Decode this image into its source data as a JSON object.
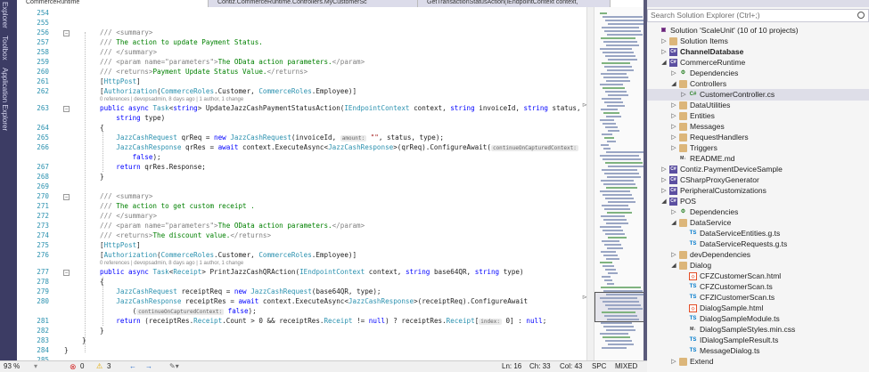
{
  "left_tabs": [
    "Explorer",
    "Toolbox",
    "Application Explorer"
  ],
  "tabs": [
    {
      "label": "CommerceRuntime"
    },
    {
      "label": "Contiz.CommerceRuntime.Controllers.MyCustomerSc"
    },
    {
      "label": "GetTransactionStatusAction(IEndpointContext context,"
    }
  ],
  "editor": {
    "lines": [
      {
        "num": "254"
      },
      {
        "num": "255"
      },
      {
        "num": "256",
        "text": "/// <summary>"
      },
      {
        "num": "257",
        "text": "/// The action to update Payment Status."
      },
      {
        "num": "258",
        "text": "/// </summary>"
      },
      {
        "num": "259",
        "text": "/// <param name=\"parameters\">The OData action parameters.</param>"
      },
      {
        "num": "260",
        "text": "/// <returns>Payment Update Status Value.</returns>"
      },
      {
        "num": "261",
        "text": "[HttpPost]"
      },
      {
        "num": "262",
        "text": "[Authorization(CommerceRoles.Customer, CommerceRoles.Employee)]"
      },
      {
        "num": "263",
        "text": "public async Task<string> UpdateJazzCashPaymentStatusAction(IEndpointContext context, string invoiceId, string status,"
      },
      {
        "num": "",
        "text": "    string type)"
      },
      {
        "num": "264",
        "text": "{"
      },
      {
        "num": "265",
        "text": "    JazzCashRequest qrReq = new JazzCashRequest(invoiceId, amount: \"\", status, type);"
      },
      {
        "num": "266",
        "text": "    JazzCashResponse qrRes = await context.ExecuteAsync<JazzCashResponse>(qrReq).ConfigureAwait(continueOnCapturedContext:"
      },
      {
        "num": "",
        "text": "        false);"
      },
      {
        "num": "267",
        "text": "    return qrRes.Response;"
      },
      {
        "num": "268",
        "text": "}"
      },
      {
        "num": "269"
      },
      {
        "num": "270",
        "text": "/// <summary>"
      },
      {
        "num": "271",
        "text": "/// The action to get custom receipt ."
      },
      {
        "num": "272",
        "text": "/// </summary>"
      },
      {
        "num": "273",
        "text": "/// <param name=\"parameters\">The OData action parameters.</param>"
      },
      {
        "num": "274",
        "text": "/// <returns>The discount value.</returns>"
      },
      {
        "num": "275",
        "text": "[HttpPost]"
      },
      {
        "num": "276",
        "text": "[Authorization(CommerceRoles.Customer, CommerceRoles.Employee)]"
      },
      {
        "num": "277",
        "text": "public async Task<Receipt> PrintJazzCashQRAction(IEndpointContext context, string base64QR, string type)"
      },
      {
        "num": "278",
        "text": "{"
      },
      {
        "num": "279",
        "text": "    JazzCashRequest receiptReq = new JazzCashRequest(base64QR, type);"
      },
      {
        "num": "280",
        "text": "    JazzCashResponse receiptRes = await context.ExecuteAsync<JazzCashResponse>(receiptReq).ConfigureAwait"
      },
      {
        "num": "",
        "text": "        (continueOnCapturedContext: false);"
      },
      {
        "num": "281",
        "text": "    return (receiptRes.Receipt.Count > 0 && receiptRes.Receipt != null) ? receiptRes.Receipt[index: 0] : null;"
      },
      {
        "num": "282",
        "text": "}"
      },
      {
        "num": "283",
        "text": "}"
      },
      {
        "num": "284",
        "text": "}"
      },
      {
        "num": "285"
      }
    ],
    "codelens_1": "0 references | devopsadmin, 8 days ago | 1 author, 1 change",
    "codelens_2": "0 references | devopsadmin, 8 days ago | 1 author, 1 change"
  },
  "solution_explorer": {
    "search_placeholder": "Search Solution Explorer (Ctrl+;)",
    "nodes": [
      {
        "label": "Solution 'ScaleUnit' (10 of 10 projects)",
        "icon": "solution-icon"
      },
      {
        "label": "Solution Items",
        "icon": "folder-icon"
      },
      {
        "label": "ChannelDatabase",
        "icon": "project-icon"
      },
      {
        "label": "CommerceRuntime",
        "icon": "csharp-project-icon"
      },
      {
        "label": "Dependencies",
        "icon": "dependencies-icon"
      },
      {
        "label": "Controllers",
        "icon": "folder-icon"
      },
      {
        "label": "CustomerController.cs",
        "icon": "csharp-file-icon"
      },
      {
        "label": "DataUtilities",
        "icon": "folder-icon"
      },
      {
        "label": "Entities",
        "icon": "folder-icon"
      },
      {
        "label": "Messages",
        "icon": "folder-icon"
      },
      {
        "label": "RequestHandlers",
        "icon": "folder-icon"
      },
      {
        "label": "Triggers",
        "icon": "folder-icon"
      },
      {
        "label": "README.md",
        "icon": "markdown-icon"
      },
      {
        "label": "Contiz.PaymentDeviceSample",
        "icon": "csharp-project-icon"
      },
      {
        "label": "CSharpProxyGenerator",
        "icon": "csharp-project-icon"
      },
      {
        "label": "PeripheralCustomizations",
        "icon": "csharp-project-icon"
      },
      {
        "label": "POS",
        "icon": "project-icon"
      },
      {
        "label": "Dependencies",
        "icon": "dependencies-icon"
      },
      {
        "label": "DataService",
        "icon": "folder-icon"
      },
      {
        "label": "DataServiceEntities.g.ts",
        "icon": "typescript-file-icon"
      },
      {
        "label": "DataServiceRequests.g.ts",
        "icon": "typescript-file-icon"
      },
      {
        "label": "devDependencies",
        "icon": "folder-icon"
      },
      {
        "label": "Dialog",
        "icon": "folder-icon"
      },
      {
        "label": "CFZCustomerScan.html",
        "icon": "html-file-icon"
      },
      {
        "label": "CFZCustomerScan.ts",
        "icon": "typescript-file-icon"
      },
      {
        "label": "CFZICustomerScan.ts",
        "icon": "typescript-file-icon"
      },
      {
        "label": "DialogSample.html",
        "icon": "html-file-icon"
      },
      {
        "label": "DialogSampleModule.ts",
        "icon": "typescript-file-icon"
      },
      {
        "label": "DialogSampleStyles.min.css",
        "icon": "css-file-icon"
      },
      {
        "label": "IDialogSampleResult.ts",
        "icon": "typescript-file-icon"
      },
      {
        "label": "MessageDialog.ts",
        "icon": "typescript-file-icon"
      },
      {
        "label": "Extend",
        "icon": "folder-icon"
      }
    ]
  },
  "status_bar": {
    "zoom": "93 %",
    "errors": "0",
    "warnings": "3",
    "line": "Ln: 16",
    "char": "Ch: 33",
    "col": "Col: 43",
    "whitespace": "SPC",
    "line_endings": "MIXED"
  }
}
